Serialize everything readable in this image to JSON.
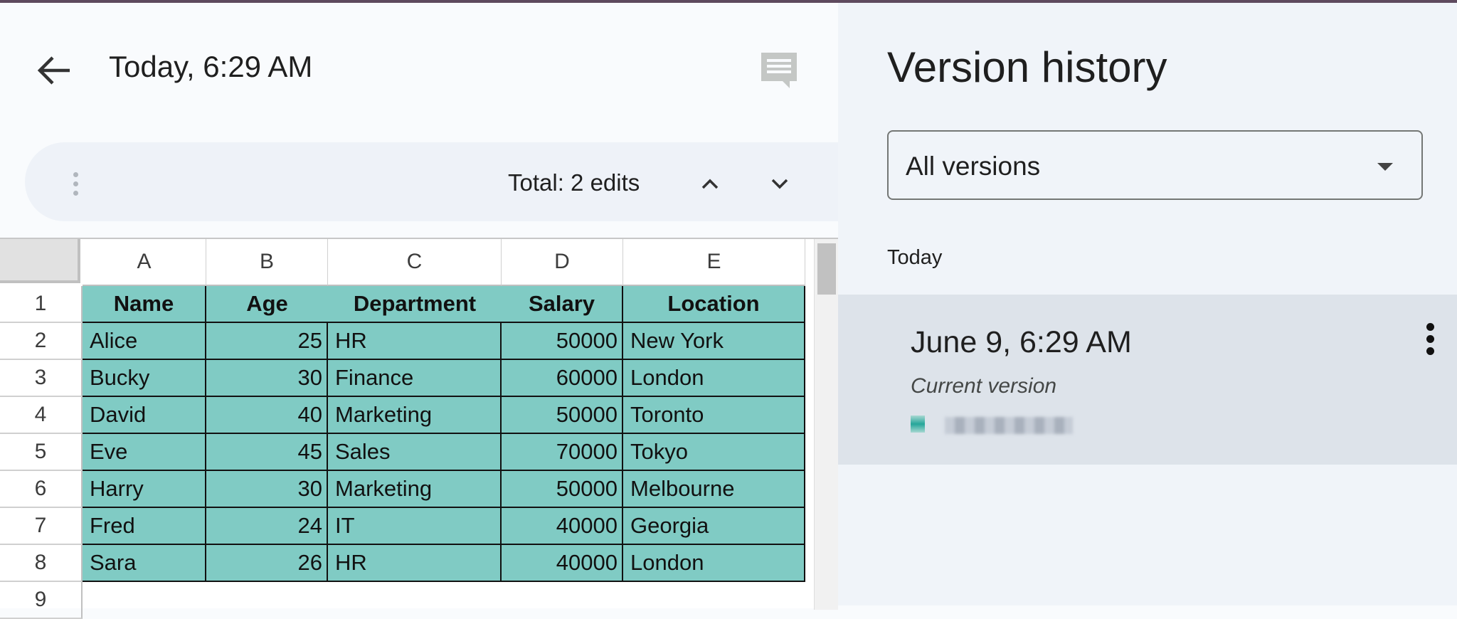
{
  "header": {
    "title": "Today, 6:29 AM",
    "back_icon": "arrow-left-icon",
    "comment_icon": "comment-icon"
  },
  "edits_bar": {
    "total": "Total: 2 edits"
  },
  "sheet": {
    "columns": [
      "A",
      "B",
      "C",
      "D",
      "E"
    ],
    "row_numbers": [
      "1",
      "2",
      "3",
      "4",
      "5",
      "6",
      "7",
      "8",
      "9"
    ],
    "headers": [
      "Name",
      "Age",
      "Department",
      "Salary",
      "Location"
    ],
    "rows": [
      [
        "Alice",
        "25",
        "HR",
        "50000",
        "New York"
      ],
      [
        "Bucky",
        "30",
        "Finance",
        "60000",
        "London"
      ],
      [
        "David",
        "40",
        "Marketing",
        "50000",
        "Toronto"
      ],
      [
        "Eve",
        "45",
        "Sales",
        "70000",
        "Tokyo"
      ],
      [
        "Harry",
        "30",
        "Marketing",
        "50000",
        "Melbourne"
      ],
      [
        "Fred",
        "24",
        "IT",
        "40000",
        "Georgia"
      ],
      [
        "Sara",
        "26",
        "HR",
        "40000",
        "London"
      ]
    ],
    "fill_color": "#80cbc4"
  },
  "panel": {
    "title": "Version history",
    "filter": "All versions",
    "group": "Today",
    "versions": [
      {
        "time": "June 9, 6:29 AM",
        "label": "Current version"
      }
    ]
  }
}
